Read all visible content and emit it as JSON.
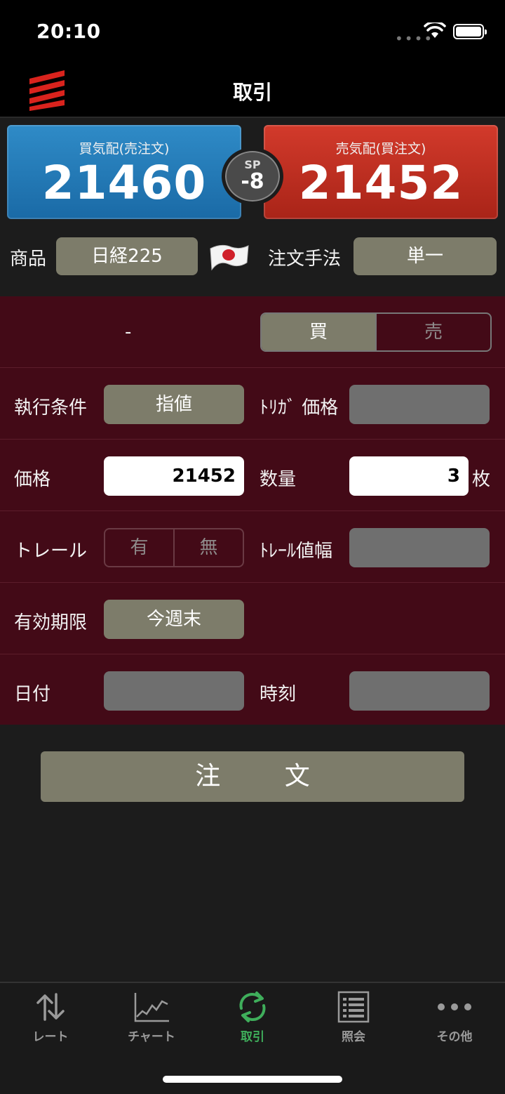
{
  "status": {
    "time": "20:10"
  },
  "header": {
    "title": "取引"
  },
  "quote": {
    "buy_label": "買気配(売注文)",
    "buy_value": "21460",
    "sell_label": "売気配(買注文)",
    "sell_value": "21452",
    "sp_label": "SP",
    "sp_value": "-8"
  },
  "product": {
    "label": "商品",
    "value": "日経225",
    "method_label": "注文手法",
    "method_value": "単一"
  },
  "form": {
    "position_text": "-",
    "side_buy": "買",
    "side_sell": "売",
    "exec_label": "執行条件",
    "exec_value": "指値",
    "trigger_label": "ﾄﾘｶﾞ 価格",
    "price_label": "価格",
    "price_value": "21452",
    "qty_label": "数量",
    "qty_value": "3",
    "qty_unit": "枚",
    "trail_label": "トレール",
    "trail_on": "有",
    "trail_off": "無",
    "trail_width_label": "ﾄﾚｰﾙ値幅",
    "expiry_label": "有効期限",
    "expiry_value": "今週末",
    "date_label": "日付",
    "time_label": "時刻"
  },
  "order_button": "注 文",
  "tabs": [
    {
      "label": "レート",
      "icon": "arrows-updown-icon"
    },
    {
      "label": "チャート",
      "icon": "chart-icon"
    },
    {
      "label": "取引",
      "icon": "refresh-icon"
    },
    {
      "label": "照会",
      "icon": "list-icon"
    },
    {
      "label": "その他",
      "icon": "more-icon"
    }
  ],
  "colors": {
    "buy": "#1a6aa6",
    "sell": "#a92418",
    "form_bg": "#430a17",
    "active_tab": "#3fae5b"
  }
}
